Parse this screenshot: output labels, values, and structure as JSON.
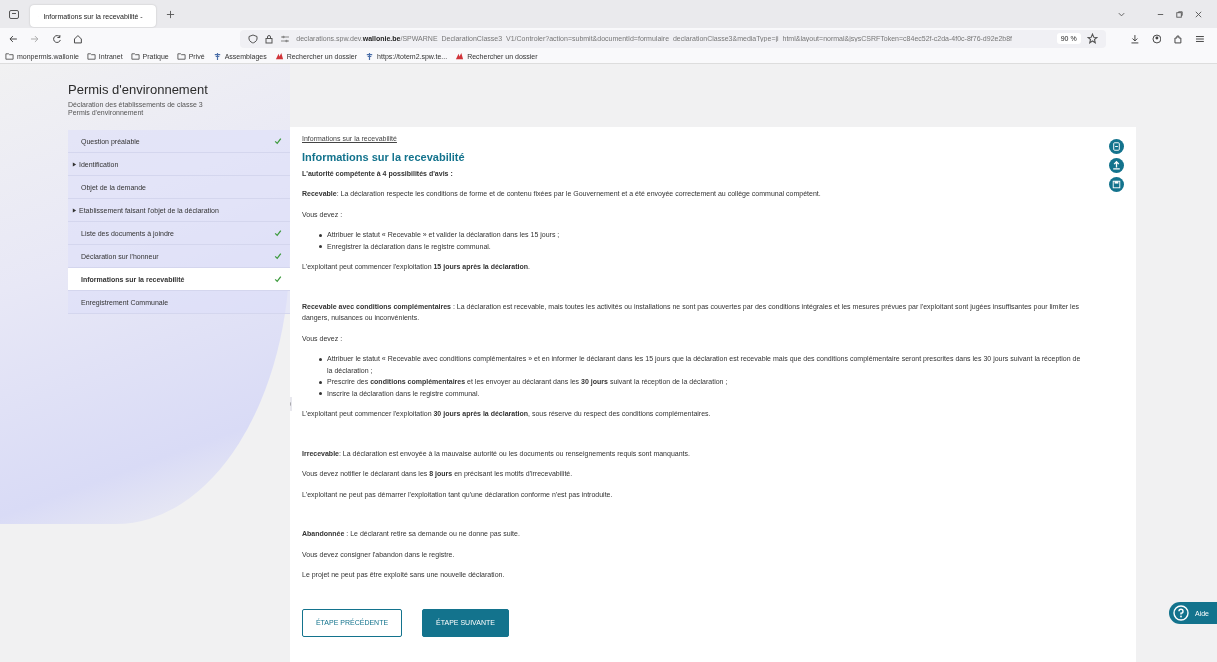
{
  "browser": {
    "tab_title": "Informations sur la recevabilité - ",
    "url_prefix": "declarations.spw.dev.",
    "url_domain": "wallonie.be",
    "url_rest": "/SPWARNE_DeclarationClasse3_V1/Controler?action=submit&documentId=formulaire_declarationClasse3&mediaType=ji_html&layout=normal&jsysCSRFToken=c84ec52f-c2da-4f0c-8f76-d92e2b8f",
    "zoom": "90 %",
    "bookmarks": [
      {
        "kind": "folder",
        "label": "monpermis.wallonie"
      },
      {
        "kind": "folder",
        "label": "Intranet"
      },
      {
        "kind": "folder",
        "label": "Pratique"
      },
      {
        "kind": "folder",
        "label": "Privé"
      },
      {
        "kind": "totem",
        "label": "Assemblages"
      },
      {
        "kind": "rooster",
        "label": "Rechercher un dossier"
      },
      {
        "kind": "totem",
        "label": "https://totem2.spw.te..."
      },
      {
        "kind": "rooster",
        "label": "Rechercher un dossier"
      }
    ]
  },
  "header": {
    "title": "Permis d'environnement",
    "subtitle": "Déclaration des établissements de classe 3",
    "subtitle_2": "Permis d'environnement"
  },
  "sidebar": {
    "items": [
      {
        "label": "Question préalable",
        "expandable": false,
        "checked": true,
        "selected": false
      },
      {
        "label": "Identification",
        "expandable": true,
        "checked": false,
        "selected": false
      },
      {
        "label": "Objet de la demande",
        "expandable": false,
        "checked": false,
        "selected": false
      },
      {
        "label": "Etablissement faisant l'objet de la déclaration",
        "expandable": true,
        "checked": false,
        "selected": false
      },
      {
        "label": "Liste des documents à joindre",
        "expandable": false,
        "checked": true,
        "selected": false
      },
      {
        "label": "Déclaration sur l'honneur",
        "expandable": false,
        "checked": true,
        "selected": false
      },
      {
        "label": "Informations sur la recevabilité",
        "expandable": false,
        "checked": true,
        "selected": true
      },
      {
        "label": "Enregistrement Communale",
        "expandable": false,
        "checked": false,
        "selected": false
      }
    ]
  },
  "content": {
    "breadcrumb": "Informations sur la recevabilité",
    "title": "Informations sur la recevabilité",
    "intro": "L'autorité compétente à 4 possibilités d'avis :",
    "sections": [
      {
        "blocks": [
          {
            "kind": "p",
            "text": "**Recevable**: La déclaration respecte les conditions de forme et de contenu fixées par le Gouvernement et a été envoyée correctement au collège communal compétent."
          },
          {
            "kind": "p",
            "text": "Vous devez :"
          },
          {
            "kind": "list",
            "items": [
              "Attribuer le statut « Recevable » et valider la déclaration dans les 15 jours ;",
              "Enregistrer la déclaration dans le registre communal."
            ]
          },
          {
            "kind": "p",
            "text": "L'exploitant peut commencer l'exploitation **15 jours après la déclaration**."
          }
        ]
      },
      {
        "blocks": [
          {
            "kind": "p",
            "text": "**Recevable avec conditions complémentaires** : La déclaration est recevable, mais toutes les activités ou installations ne sont pas couvertes par des conditions intégrales et les mesures prévues par l'exploitant sont jugées insuffisantes pour limiter les dangers, nuisances ou inconvénients."
          },
          {
            "kind": "p",
            "text": "Vous devez :"
          },
          {
            "kind": "list",
            "items": [
              "Attribuer le statut « Recevable avec conditions complémentaires » et en informer le déclarant dans les 15 jours que la déclaration est recevable mais que des conditions complémentaire seront prescrites dans les 30 jours suivant la réception de la déclaration ;",
              "Prescrire des **conditions complémentaires** et les envoyer au déclarant dans les **30 jours** suivant la réception de la déclaration ;",
              "Inscrire la déclaration dans le registre communal."
            ]
          },
          {
            "kind": "p",
            "text": "L'exploitant peut commencer l'exploitation **30 jours après la déclaration**, sous réserve du respect des conditions complémentaires."
          }
        ]
      },
      {
        "blocks": [
          {
            "kind": "p",
            "text": "**Irrecevable**: La déclaration est envoyée à la mauvaise autorité ou les documents ou renseignements requis sont manquants."
          },
          {
            "kind": "p",
            "text": "Vous devez notifier le déclarant dans les **8 jours** en précisant les motifs d'irrecevabilité."
          },
          {
            "kind": "p",
            "text": "L'exploitant ne peut pas démarrer l'exploitation tant qu'une déclaration conforme n'est pas introduite."
          }
        ]
      },
      {
        "blocks": [
          {
            "kind": "p",
            "text": "**Abandonnée** : Le déclarant retire sa demande ou ne donne pas suite."
          },
          {
            "kind": "p",
            "text": "Vous devez consigner l'abandon dans le registre."
          },
          {
            "kind": "p",
            "text": "Le projet ne peut pas être exploité sans une nouvelle déclaration."
          }
        ]
      }
    ],
    "buttons": [
      {
        "label": "ÉTAPE PRÉCÉDENTE",
        "kind": "outline"
      },
      {
        "label": "ÉTAPE SUIVANTE",
        "kind": "filled"
      }
    ]
  },
  "help": {
    "label": "Aide"
  }
}
